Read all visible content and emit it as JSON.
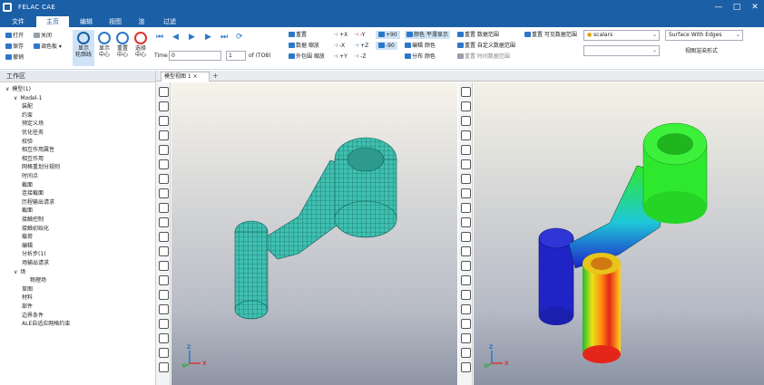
{
  "app": {
    "title": "FELAC CAE",
    "window_controls": [
      "—",
      "□",
      "✕"
    ]
  },
  "menu": {
    "tabs": [
      "文件",
      "主页",
      "编辑",
      "视图",
      "渲",
      "过滤"
    ]
  },
  "ribbon": {
    "file": {
      "open": "打开",
      "save": "保存",
      "undo": "撤销",
      "close": "关闭",
      "font": "调色板"
    },
    "big": {
      "display_outline": "显示\n轮廓线",
      "display_center": "显示\n中心",
      "reset_center": "重置\n中心",
      "select_center": "选择\n中心"
    },
    "time_label": "Time",
    "time_value": "0",
    "frame_value": "1",
    "of_label": "of (TO8)",
    "view_ops": [
      "重置",
      "数据 缩放",
      "外包围 缩放"
    ],
    "axes_col1": [
      "+X",
      "-X",
      "+Y"
    ],
    "axes_col2": [
      "-Y",
      "+Z",
      "-Z"
    ],
    "rot": [
      "+90",
      "-90"
    ],
    "color_ops": [
      "颜色 平滑显示",
      "编辑 颜色",
      "分布 颜色"
    ],
    "range_ops": [
      "重置 数据范围",
      "重置 自定义数据范围",
      "重置 时间数据范围"
    ],
    "visible_range": "重置 可见数据范围",
    "scalar_select": "scalars",
    "surface_select": "Surface With Edges",
    "render_mode": "视图渲染形式"
  },
  "workspace": {
    "title": "工作区",
    "tree": [
      {
        "label": "模型(1)",
        "depth": 0,
        "arrow": "∨"
      },
      {
        "label": "Model-1",
        "depth": 1,
        "arrow": "∨"
      },
      {
        "label": "装配",
        "depth": 2
      },
      {
        "label": "约束",
        "depth": 2
      },
      {
        "label": "预定义场",
        "depth": 2
      },
      {
        "label": "优化任务",
        "depth": 2
      },
      {
        "label": "校验",
        "depth": 2
      },
      {
        "label": "相互作用属性",
        "depth": 2
      },
      {
        "label": "相互作用",
        "depth": 2
      },
      {
        "label": "网格重划分规则",
        "depth": 2
      },
      {
        "label": "时间点",
        "depth": 2
      },
      {
        "label": "截面",
        "depth": 2
      },
      {
        "label": "连接截面",
        "depth": 2
      },
      {
        "label": "历程输出请求",
        "depth": 2
      },
      {
        "label": "截面",
        "depth": 2
      },
      {
        "label": "接触控制",
        "depth": 2
      },
      {
        "label": "接触初始化",
        "depth": 2
      },
      {
        "label": "载荷",
        "depth": 2
      },
      {
        "label": "编辑",
        "depth": 2
      },
      {
        "label": "分析步(1)",
        "depth": 2
      },
      {
        "label": "场输出请求",
        "depth": 2
      },
      {
        "label": "场",
        "depth": 1,
        "arrow": "∨"
      },
      {
        "label": "物理场",
        "depth": 3
      },
      {
        "label": "草图",
        "depth": 2
      },
      {
        "label": "材料",
        "depth": 2
      },
      {
        "label": "部件",
        "depth": 2
      },
      {
        "label": "边界条件",
        "depth": 2
      },
      {
        "label": "ALE自适应网格约束",
        "depth": 2
      }
    ]
  },
  "document": {
    "tab": "模型视图 1",
    "add": "+"
  },
  "colors": {
    "accent": "#1b5fa6",
    "mesh": "#3fbfb0",
    "contour_high": "#2ee82e",
    "contour_low": "#1d22c9"
  },
  "axis_labels": [
    "Z",
    "X",
    "Y"
  ]
}
